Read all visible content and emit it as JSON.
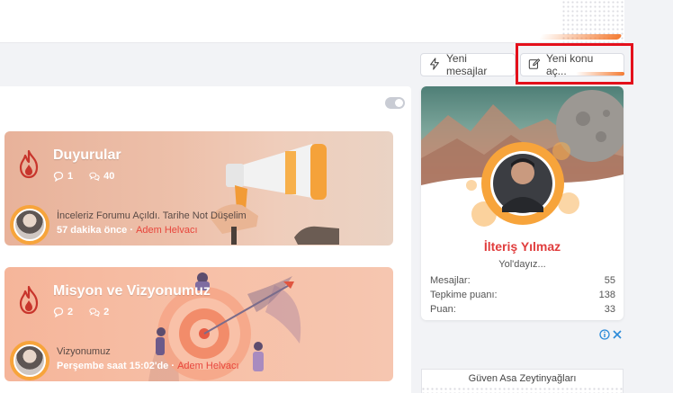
{
  "header": {
    "new_posts_label": "Yeni mesajlar",
    "new_thread_label": "Yeni konu aç..."
  },
  "forums": [
    {
      "title": "Duyurular",
      "threads": "1",
      "messages": "40",
      "last_post_title": "İnceleriz Forumu Açıldı. Tarihe Not Düşelim",
      "last_post_time": "57 dakika önce",
      "last_post_sep": " · ",
      "last_post_user": "Adem Helvacı"
    },
    {
      "title": "Misyon ve Vizyonumuz",
      "threads": "2",
      "messages": "2",
      "last_post_title": "Vizyonumuz",
      "last_post_time": "Perşembe saat 15:02'de",
      "last_post_sep": " · ",
      "last_post_user": "Adem Helvacı"
    }
  ],
  "profile": {
    "name": "İlteriş Yılmaz",
    "status": "Yol'dayız...",
    "stats": [
      {
        "label": "Mesajlar:",
        "value": "55"
      },
      {
        "label": "Tepkime puanı:",
        "value": "138"
      },
      {
        "label": "Puan:",
        "value": "33"
      }
    ]
  },
  "ad": {
    "title": "Güven Asa Zeytinyağları"
  },
  "colors": {
    "accent": "#f47c33",
    "profile_name": "#e03d3d",
    "user_link": "#e8463c",
    "highlight_box": "#e4101b"
  }
}
